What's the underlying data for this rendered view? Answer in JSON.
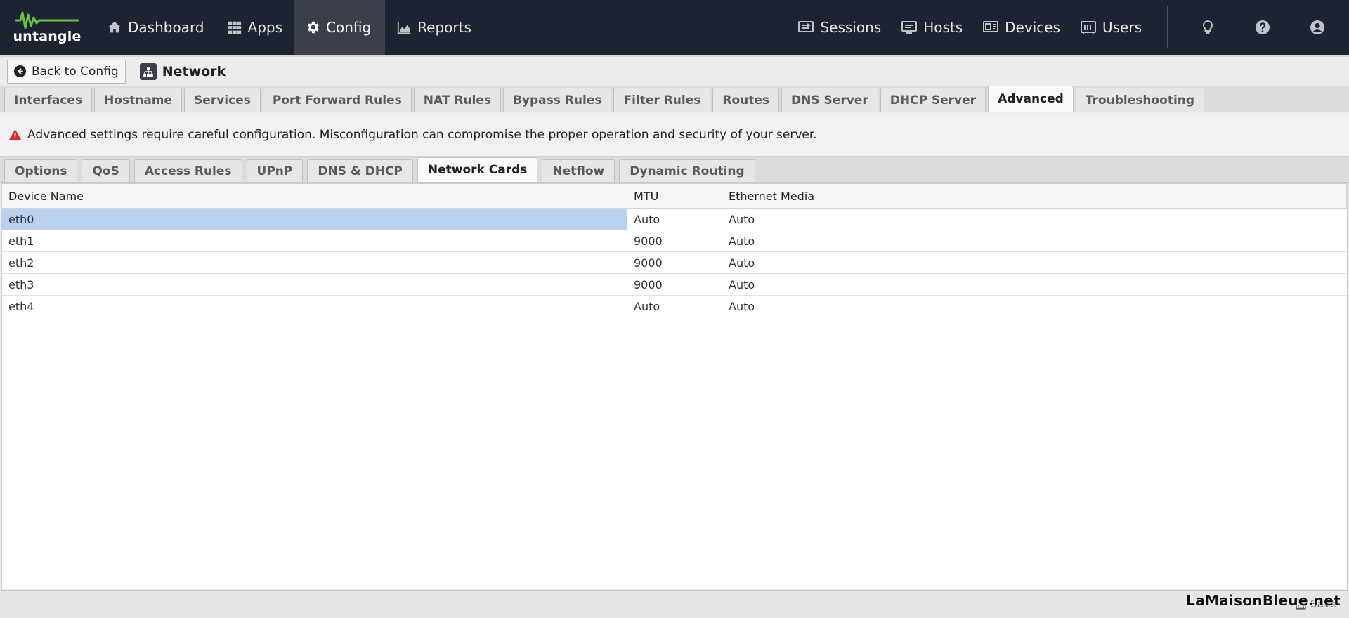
{
  "logo": {
    "text": "untangle",
    "color": "#6cc04a"
  },
  "nav": {
    "left": [
      {
        "label": "Dashboard",
        "icon": "home-icon"
      },
      {
        "label": "Apps",
        "icon": "grid-icon"
      },
      {
        "label": "Config",
        "icon": "gear-icon",
        "active": true
      },
      {
        "label": "Reports",
        "icon": "area-chart-icon"
      }
    ],
    "right": [
      {
        "label": "Sessions",
        "icon": "sessions-icon"
      },
      {
        "label": "Hosts",
        "icon": "hosts-icon"
      },
      {
        "label": "Devices",
        "icon": "devices-icon"
      },
      {
        "label": "Users",
        "icon": "users-icon"
      }
    ]
  },
  "subhead": {
    "back_label": "Back to Config",
    "title": "Network"
  },
  "main_tabs": [
    "Interfaces",
    "Hostname",
    "Services",
    "Port Forward Rules",
    "NAT Rules",
    "Bypass Rules",
    "Filter Rules",
    "Routes",
    "DNS Server",
    "DHCP Server",
    "Advanced",
    "Troubleshooting"
  ],
  "main_tab_active": "Advanced",
  "warning": "Advanced settings require careful configuration. Misconfiguration can compromise the proper operation and security of your server.",
  "sub_tabs": [
    "Options",
    "QoS",
    "Access Rules",
    "UPnP",
    "DNS & DHCP",
    "Network Cards",
    "Netflow",
    "Dynamic Routing"
  ],
  "sub_tab_active": "Network Cards",
  "grid": {
    "columns": [
      "Device Name",
      "MTU",
      "Ethernet Media"
    ],
    "rows": [
      [
        "eth0",
        "Auto",
        "Auto"
      ],
      [
        "eth1",
        "9000",
        "Auto"
      ],
      [
        "eth2",
        "9000",
        "Auto"
      ],
      [
        "eth3",
        "9000",
        "Auto"
      ],
      [
        "eth4",
        "Auto",
        "Auto"
      ]
    ],
    "selected_row": 0
  },
  "footer": {
    "save_label": "Save"
  },
  "watermark": "LaMaisonBleue.net"
}
